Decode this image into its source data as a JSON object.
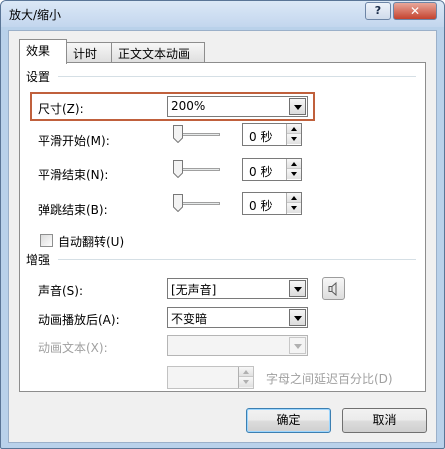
{
  "window": {
    "title": "放大/缩小",
    "help_label": "?",
    "close_label": "✕"
  },
  "tabs": [
    {
      "label": "效果",
      "active": true
    },
    {
      "label": "计时",
      "active": false
    },
    {
      "label": "正文文本动画",
      "active": false
    }
  ],
  "settings": {
    "section_label": "设置",
    "size": {
      "label": "尺寸(Z):",
      "value": "200%"
    },
    "smooth_start": {
      "label": "平滑开始(M):",
      "value": "0 秒"
    },
    "smooth_end": {
      "label": "平滑结束(N):",
      "value": "0 秒"
    },
    "bounce_end": {
      "label": "弹跳结束(B):",
      "value": "0 秒"
    },
    "auto_reverse": {
      "label": "自动翻转(U)",
      "checked": false
    }
  },
  "enhancements": {
    "section_label": "增强",
    "sound": {
      "label": "声音(S):",
      "value": "[无声音]"
    },
    "after_animation": {
      "label": "动画播放后(A):",
      "value": "不变暗"
    },
    "animate_text": {
      "label": "动画文本(X):",
      "value": "",
      "enabled": false
    },
    "delay_between_letters": {
      "label": "字母之间延迟百分比(D)",
      "value": "",
      "enabled": false
    }
  },
  "buttons": {
    "ok": "确定",
    "cancel": "取消"
  },
  "icons": {
    "help": "help-icon",
    "close": "close-icon",
    "dropdown": "chevron-down-icon",
    "speaker": "speaker-icon"
  },
  "colors": {
    "highlight_border": "#c0603c",
    "default_button_border": "#3c7fb1",
    "close_button": "#c4432f"
  }
}
